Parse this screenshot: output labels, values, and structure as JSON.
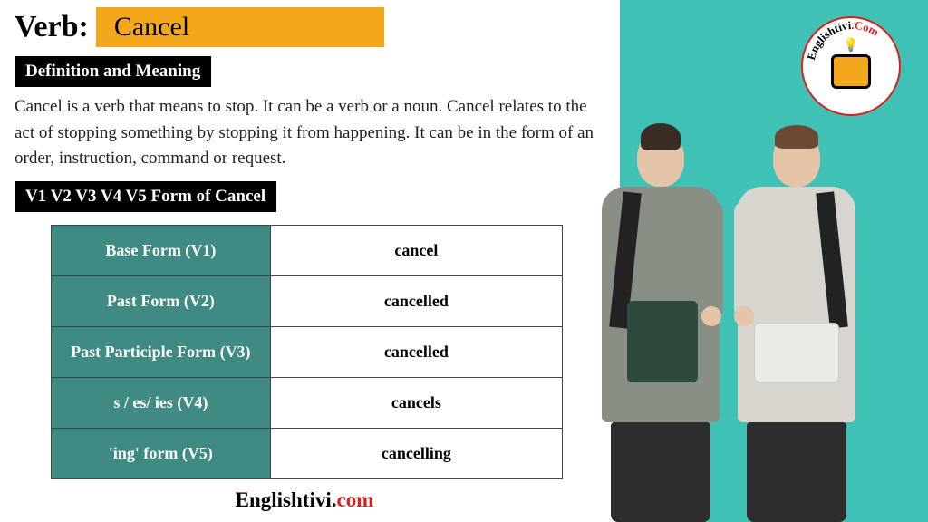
{
  "header": {
    "label": "Verb:",
    "word": "Cancel"
  },
  "sections": {
    "definition_label": "Definition and Meaning",
    "definition_text": "Cancel is a verb that means to stop. It can be a verb or a noun. Cancel relates to the act of stopping something by stopping it from happening. It can be in the form of an order, instruction, command or request.",
    "forms_label": "V1 V2 V3 V4 V5 Form of Cancel"
  },
  "forms": [
    {
      "label": "Base Form (V1)",
      "value": "cancel"
    },
    {
      "label": "Past Form (V2)",
      "value": "cancelled"
    },
    {
      "label": "Past Participle Form (V3)",
      "value": "cancelled"
    },
    {
      "label": "s / es/ ies (V4)",
      "value": "cancels"
    },
    {
      "label": "'ing' form (V5)",
      "value": "cancelling"
    }
  ],
  "brand": {
    "name": "Englishtivi",
    "dot": ".",
    "tld": "com",
    "logo_text_main": "Englishtivi",
    "logo_text_tld": ".Com"
  }
}
